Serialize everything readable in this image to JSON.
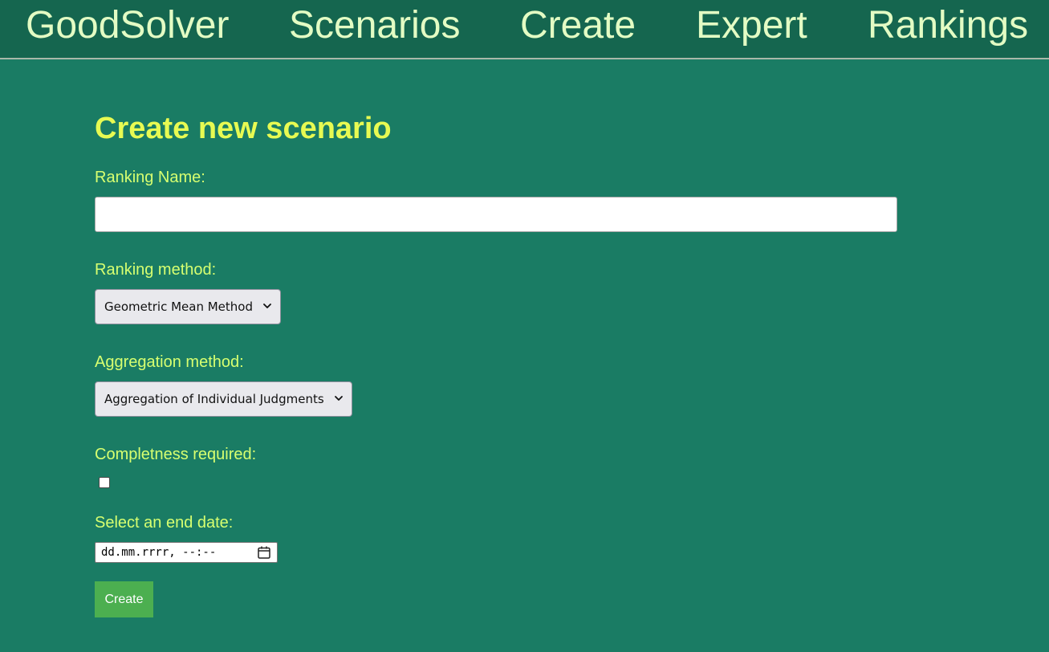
{
  "nav": {
    "brand": "GoodSolver",
    "items": [
      {
        "label": "Scenarios"
      },
      {
        "label": "Create"
      },
      {
        "label": "Expert"
      },
      {
        "label": "Rankings"
      }
    ]
  },
  "form": {
    "title": "Create new scenario",
    "ranking_name": {
      "label": "Ranking Name:",
      "value": ""
    },
    "ranking_method": {
      "label": "Ranking method:",
      "selected": "Geometric Mean Method"
    },
    "aggregation_method": {
      "label": "Aggregation method:",
      "selected": "Aggregation of Individual Judgments"
    },
    "completeness": {
      "label": "Completness required:",
      "checked": false
    },
    "end_date": {
      "label": "Select an end date:",
      "placeholder": "dd.mm.rrrr, --:--"
    },
    "submit_label": "Create"
  },
  "colors": {
    "background": "#1a7c64",
    "nav_background": "#15664f",
    "nav_text": "#e3fcc4",
    "title": "#e7fa52",
    "label": "#d7ff70",
    "button": "#4caf50"
  },
  "icons": {
    "select_chevron": "chevron-down-icon",
    "date_picker": "calendar-icon"
  }
}
